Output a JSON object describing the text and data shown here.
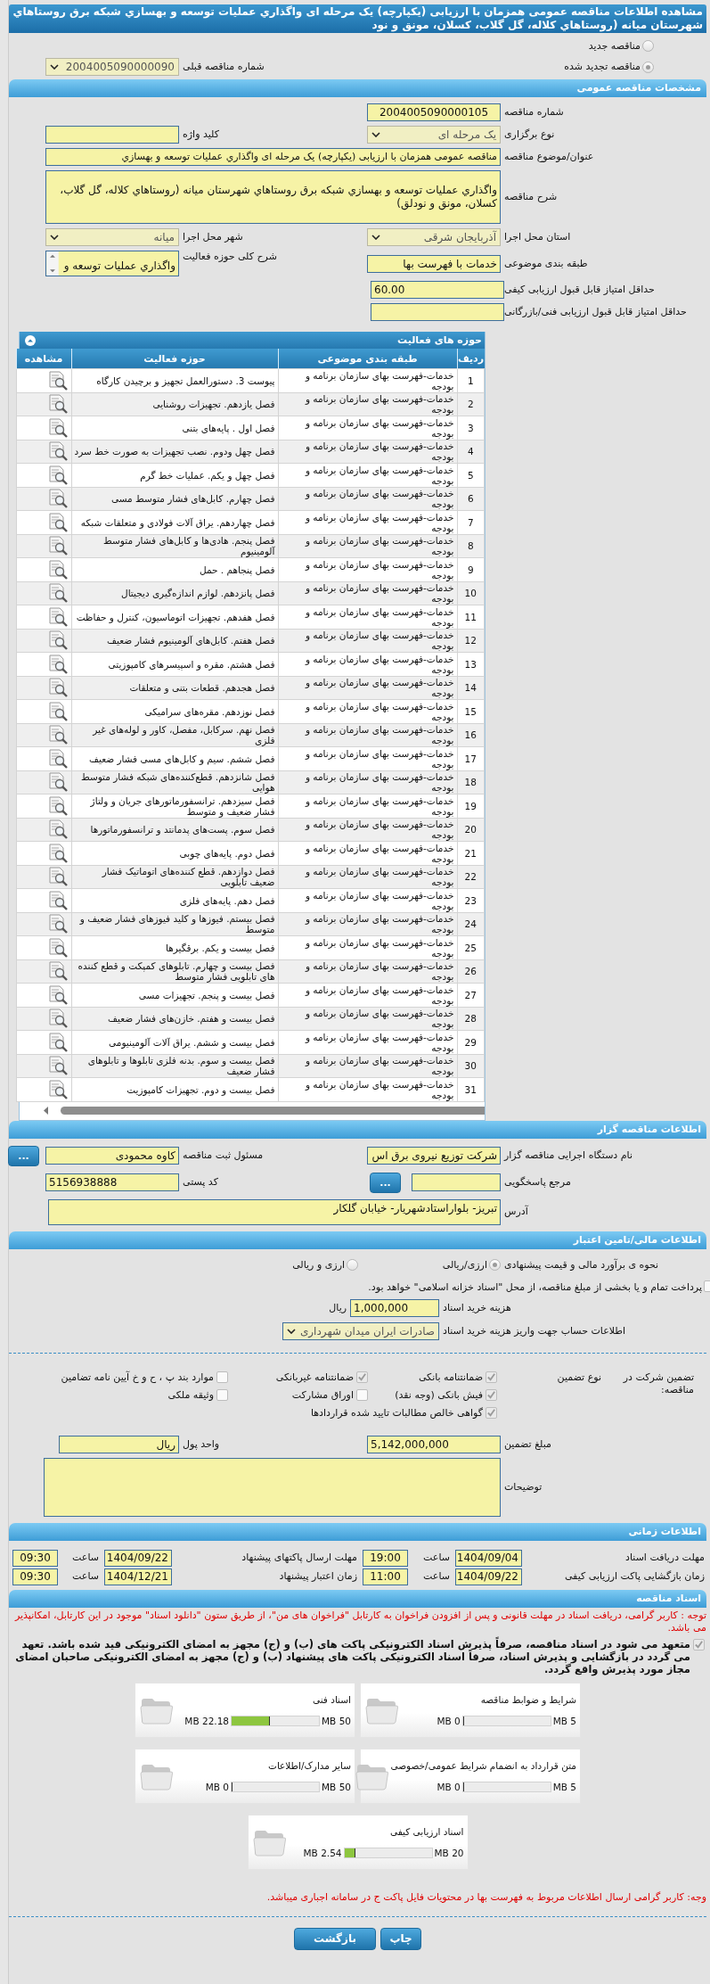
{
  "title": "مشاهده اطلاعات مناقصه عمومی همزمان با ارزیابی (یکپارچه) یک مرحله ای واگذاري عمليات توسعه و بهسازي شبکه برق روستاهاي شهرستان ميانه (روستاهاي کلاله، گل گلاب، کسلان، مونق و نود",
  "tender_type": [
    {
      "label": "مناقصه جدید",
      "selected": false
    },
    {
      "label": "مناقصه تجدید شده",
      "selected": true
    }
  ],
  "previous_tender": {
    "label": "شماره مناقصه قبلی",
    "value": "2004005090000090"
  },
  "general": {
    "heading": "مشخصات مناقصه عمومی",
    "tender_number": {
      "label": "شماره مناقصه",
      "value": "2004005090000105"
    },
    "holding_type": {
      "label": "نوع برگزاری",
      "value": "یک مرحله ای"
    },
    "keyword": {
      "label": "کلید واژه"
    },
    "subject": {
      "label": "عنوان/موضوع مناقصه",
      "value": "مناقصه عمومی همزمان با ارزیابی (یکپارچه) یک مرحله ای واگذاري عمليات توسعه و بهسازي"
    },
    "description": {
      "label": "شرح مناقصه",
      "value": "واگذاري عمليات توسعه و بهسازي شبکه برق روستاهاي شهرستان ميانه (روستاهاي کلاله، گل گلاب، کسلان، مونق و نودلق)"
    },
    "province": {
      "label": "استان محل اجرا",
      "value": "آذربایجان شرقی"
    },
    "city": {
      "label": "شهر محل اجرا",
      "value": "میانه"
    },
    "category": {
      "label": "طبقه بندی موضوعی",
      "value": "خدمات با فهرست بها"
    },
    "activity_summary": {
      "label": "شرح کلی حوزه فعالیت",
      "value": "واگذاري عمليات توسعه و"
    },
    "min_quality_score": {
      "label": "حداقل امتیاز قابل قبول ارزیابی کیفی",
      "value": "60.00"
    },
    "min_technical_score": {
      "label": "حداقل امتیاز قابل قبول ارزیابی فنی/بازرگانی"
    }
  },
  "activities": {
    "heading": "حوزه های فعالیت",
    "columns": [
      "ردیف",
      "طبقه بندی موضوعی",
      "حوزه فعالیت",
      "مشاهده"
    ],
    "rows": [
      {
        "n": "1",
        "category": "خدمات-فهرست بهای سازمان برنامه و بودجه",
        "activity": "پیوست 3. دستورالعمل تجهیز و برچیدن کارگاه"
      },
      {
        "n": "2",
        "category": "خدمات-فهرست بهای سازمان برنامه و بودجه",
        "activity": "فصل یازدهم. تجهیزات روشنایی"
      },
      {
        "n": "3",
        "category": "خدمات-فهرست بهای سازمان برنامه و بودجه",
        "activity": "فصل اول . پایه‌های بتنی"
      },
      {
        "n": "4",
        "category": "خدمات-فهرست بهای سازمان برنامه و بودجه",
        "activity": "فصل چهل ودوم. نصب تجهیزات به صورت خط سرد"
      },
      {
        "n": "5",
        "category": "خدمات-فهرست بهای سازمان برنامه و بودجه",
        "activity": "فصل چهل و یکم. عملیات خط گرم"
      },
      {
        "n": "6",
        "category": "خدمات-فهرست بهای سازمان برنامه و بودجه",
        "activity": "فصل چهارم. کابل‌های فشار متوسط مسی"
      },
      {
        "n": "7",
        "category": "خدمات-فهرست بهای سازمان برنامه و بودجه",
        "activity": "فصل چهاردهم. یراق آلات فولادی و متعلقات شبکه"
      },
      {
        "n": "8",
        "category": "خدمات-فهرست بهای سازمان برنامه و بودجه",
        "activity": "فصل پنجم. هادی‌ها و کابل‌های فشار متوسط آلومینیوم"
      },
      {
        "n": "9",
        "category": "خدمات-فهرست بهای سازمان برنامه و بودجه",
        "activity": "فصل پنجاهم . حمل"
      },
      {
        "n": "10",
        "category": "خدمات-فهرست بهای سازمان برنامه و بودجه",
        "activity": "فصل پانزدهم. لوازم اندازه‌گیری دیجیتال"
      },
      {
        "n": "11",
        "category": "خدمات-فهرست بهای سازمان برنامه و بودجه",
        "activity": "فصل هفدهم. تجهیزات اتوماسیون، کنترل و حفاظت"
      },
      {
        "n": "12",
        "category": "خدمات-فهرست بهای سازمان برنامه و بودجه",
        "activity": "فصل هفتم. کابل‌های آلومینیوم فشار ضعیف"
      },
      {
        "n": "13",
        "category": "خدمات-فهرست بهای سازمان برنامه و بودجه",
        "activity": "فصل هشتم. مقره و اسپیسرهای کامپوزیتی"
      },
      {
        "n": "14",
        "category": "خدمات-فهرست بهای سازمان برنامه و بودجه",
        "activity": "فصل هجدهم. قطعات بتنی و متعلقات"
      },
      {
        "n": "15",
        "category": "خدمات-فهرست بهای سازمان برنامه و بودجه",
        "activity": "فصل نوزدهم. مقره‌های سرامیکی"
      },
      {
        "n": "16",
        "category": "خدمات-فهرست بهای سازمان برنامه و بودجه",
        "activity": "فصل نهم. سرکابل، مفصل، کاور و لوله‌های غیر فلزی"
      },
      {
        "n": "17",
        "category": "خدمات-فهرست بهای سازمان برنامه و بودجه",
        "activity": "فصل ششم. سیم و کابل‌های مسی فشار ضعیف"
      },
      {
        "n": "18",
        "category": "خدمات-فهرست بهای سازمان برنامه و بودجه",
        "activity": "فصل شانزدهم. قطع‌کننده‌های شبکه فشار متوسط هوایی"
      },
      {
        "n": "19",
        "category": "خدمات-فهرست بهای سازمان برنامه و بودجه",
        "activity": "فصل سیزدهم. ترانسفورماتورهای جریان و ولتاژ فشار ضعیف و متوسط"
      },
      {
        "n": "20",
        "category": "خدمات-فهرست بهای سازمان برنامه و بودجه",
        "activity": "فصل سوم. پست‌های پدمانتد و ترانسفورماتورها"
      },
      {
        "n": "21",
        "category": "خدمات-فهرست بهای سازمان برنامه و بودجه",
        "activity": "فصل دوم. پایه‌های چوبی"
      },
      {
        "n": "22",
        "category": "خدمات-فهرست بهای سازمان برنامه و بودجه",
        "activity": "فصل دوازدهم. قطع کننده‌های اتوماتیک فشار ضعیف تابلویی"
      },
      {
        "n": "23",
        "category": "خدمات-فهرست بهای سازمان برنامه و بودجه",
        "activity": "فصل دهم. پایه‌های فلزی"
      },
      {
        "n": "24",
        "category": "خدمات-فهرست بهای سازمان برنامه و بودجه",
        "activity": "فصل بیستم. فیوزها و کلید فیوزهای فشار ضعیف و متوسط"
      },
      {
        "n": "25",
        "category": "خدمات-فهرست بهای سازمان برنامه و بودجه",
        "activity": "فصل بیست و یکم. برقگیرها"
      },
      {
        "n": "26",
        "category": "خدمات-فهرست بهای سازمان برنامه و بودجه",
        "activity": "فصل بیست و چهارم. تابلوهای کمپکت و قطع کننده های تابلویی فشار متوسط"
      },
      {
        "n": "27",
        "category": "خدمات-فهرست بهای سازمان برنامه و بودجه",
        "activity": "فصل بیست و پنجم. تجهیزات مسی"
      },
      {
        "n": "28",
        "category": "خدمات-فهرست بهای سازمان برنامه و بودجه",
        "activity": "فصل بیست و هفتم. خازن‌های فشار ضعیف"
      },
      {
        "n": "29",
        "category": "خدمات-فهرست بهای سازمان برنامه و بودجه",
        "activity": "فصل بیست و ششم. یراق آلات آلومینیومی"
      },
      {
        "n": "30",
        "category": "خدمات-فهرست بهای سازمان برنامه و بودجه",
        "activity": "فصل بیست و سوم. بدنه فلزی تابلوها و تابلوهای فشار ضعیف"
      },
      {
        "n": "31",
        "category": "خدمات-فهرست بهای سازمان برنامه و بودجه",
        "activity": "فصل بیست و دوم. تجهیزات کامپوزیت"
      }
    ]
  },
  "employer": {
    "heading": "اطلاعات مناقصه گزار",
    "organization": {
      "label": "نام دستگاه اجرایی مناقصه گزار",
      "value": "شرکت توزیع نیروی برق اس"
    },
    "registrar": {
      "label": "مسئول ثبت مناقصه",
      "value": "کاوه محمودی",
      "button": "..."
    },
    "responder": {
      "label": "مرجع پاسخگویی",
      "button": "..."
    },
    "postal_code": {
      "label": "کد پستی",
      "value": "5156938888"
    },
    "address": {
      "label": "آدرس",
      "value": "تبریز- بلواراستادشهریار- خیابان گلکار"
    }
  },
  "finance": {
    "heading": "اطلاعات مالی/تامین اعتبار",
    "estimate": {
      "label": "نحوه ی برآورد مالی و قیمت پیشنهادی",
      "options": [
        {
          "label": "ارزی/ریالی",
          "selected": true
        },
        {
          "label": "ارزی و ریالی",
          "selected": false
        }
      ]
    },
    "treasury": {
      "label": "پرداخت تمام و یا بخشی از مبلغ مناقصه، از محل \"اسناد خزانه اسلامی\" خواهد بود.",
      "checked": false
    },
    "doc_fee": {
      "label": "هزینه خرید اسناد",
      "value": "1,000,000",
      "unit": "ریال"
    },
    "account": {
      "label": "اطلاعات حساب جهت واریز هزینه خرید اسناد",
      "value": "صادرات ایران میدان شهرداری"
    },
    "guarantee": {
      "label": "تضمین شرکت در مناقصه:",
      "type_label": "نوع تضمین",
      "options": [
        {
          "label": "ضمانتنامه بانکی",
          "checked": true
        },
        {
          "label": "ضمانتنامه غیربانکی",
          "checked": true
        },
        {
          "label": "موارد بند پ ، ح و خ آیین نامه تضامین",
          "checked": false
        },
        {
          "label": "فیش بانکی (وجه نقد)",
          "checked": true
        },
        {
          "label": "اوراق مشارکت",
          "checked": false
        },
        {
          "label": "وثیقه ملکی",
          "checked": false
        },
        {
          "label": "گواهی خالص مطالبات تایید شده قراردادها",
          "checked": true
        }
      ]
    },
    "amount": {
      "label": "مبلغ تضمین",
      "value": "5,142,000,000"
    },
    "currency": {
      "label": "واحد پول",
      "value": "ریال"
    },
    "notes": {
      "label": "توضیحات"
    }
  },
  "schedule": {
    "heading": "اطلاعات زمانی",
    "items": [
      {
        "label": "مهلت دریافت اسناد",
        "date": "1404/09/04",
        "time_label": "ساعت",
        "time": "19:00"
      },
      {
        "label": "مهلت ارسال پاکتهای پیشنهاد",
        "date": "1404/09/22",
        "time_label": "ساعت",
        "time": "09:30"
      },
      {
        "label": "زمان بازگشایی پاکت ارزیابی کیفی",
        "date": "1404/09/22",
        "time_label": "ساعت",
        "time": "11:00"
      },
      {
        "label": "زمان اعتبار پیشنهاد",
        "date": "1404/12/21",
        "time_label": "ساعت",
        "time": "09:30"
      }
    ]
  },
  "documents": {
    "heading": "اسناد مناقصه",
    "note": "توجه : کاربر گرامی، دریافت اسناد در مهلت قانونی و پس از افزودن فراخوان به کارتابل \"فراخوان های من\"، از طریق ستون \"دانلود اسناد\" موجود در این کارتابل، امکانپذیر می باشد.",
    "commitment": {
      "text": "متعهد می شود در اسناد مناقصه، صرفاً پذیرش اسناد الکترونیکی پاکت های (ب) و (ج) مجهز به امضای الکترونیکی قید شده باشد. تعهد می گردد در بازگشایی و پذیرش اسناد، صرفاً اسناد الکترونیکی پاکت های پیشنهاد (ب) و (ج) مجهز به امضای الکترونیکی صاحبان امضای مجاز مورد پذیرش واقع گردد.",
      "checked": true
    },
    "files": [
      {
        "name": "شرایط و ضوابط مناقصه",
        "used": "0 MB",
        "max": "5 MB",
        "level": 0
      },
      {
        "name": "اسناد فنی",
        "used": "22.18 MB",
        "max": "50 MB",
        "level": 0.4436
      },
      {
        "name": "متن قرارداد به انضمام شرایط عمومی/خصوصی",
        "used": "0 MB",
        "max": "5 MB",
        "level": 0
      },
      {
        "name": "سایر مدارک/اطلاعات",
        "used": "0 MB",
        "max": "50 MB",
        "level": 0
      },
      {
        "name": "اسناد ارزیابی کیفی",
        "used": "2.54 MB",
        "max": "20 MB",
        "level": 0.127
      }
    ],
    "footer_note": "وجه: کاربر گرامی ارسال اطلاعات مربوط به فهرست بها در محتویات فایل پاکت ج در سامانه اجباری میباشد."
  },
  "buttons": [
    "چاپ",
    "بازگشت"
  ]
}
